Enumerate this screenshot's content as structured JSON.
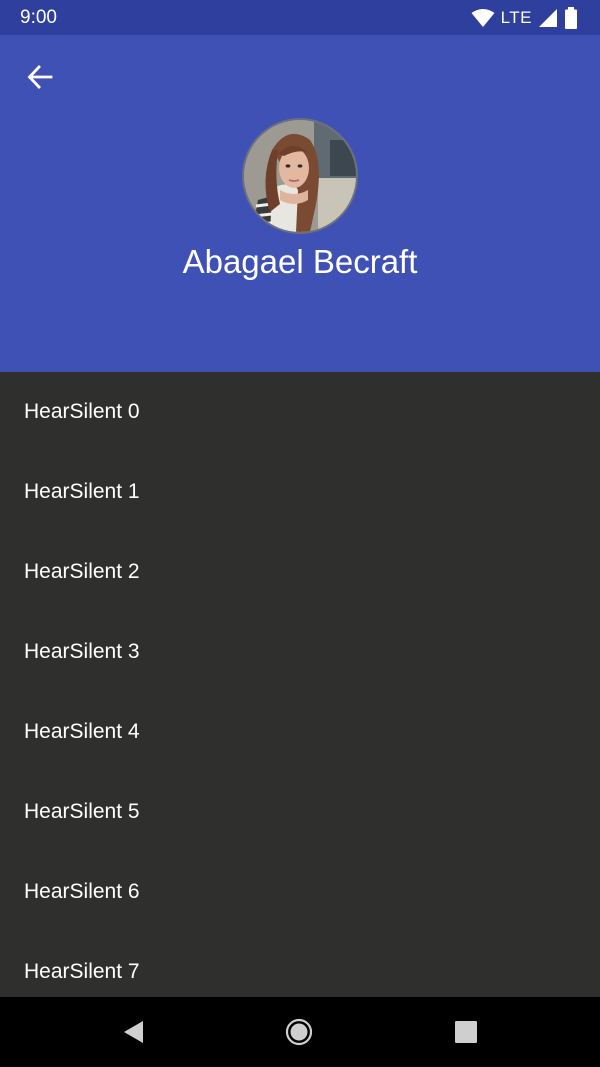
{
  "status_bar": {
    "time": "9:00",
    "network": "LTE",
    "icons": [
      "wifi-icon",
      "signal-icon",
      "battery-icon"
    ]
  },
  "header": {
    "back_icon": "arrow-back-icon",
    "profile_name": "Abagael Becraft"
  },
  "list": {
    "items": [
      {
        "label": "HearSilent 0"
      },
      {
        "label": "HearSilent 1"
      },
      {
        "label": "HearSilent 2"
      },
      {
        "label": "HearSilent 3"
      },
      {
        "label": "HearSilent 4"
      },
      {
        "label": "HearSilent 5"
      },
      {
        "label": "HearSilent 6"
      },
      {
        "label": "HearSilent 7"
      }
    ]
  },
  "nav_bar": {
    "buttons": [
      "back-triangle-icon",
      "home-circle-icon",
      "recents-square-icon"
    ]
  },
  "colors": {
    "status_bar": "#2f3f9d",
    "header": "#3f51b5",
    "list_background": "#2f302e",
    "nav_bar": "#000000",
    "text": "#ffffff"
  }
}
